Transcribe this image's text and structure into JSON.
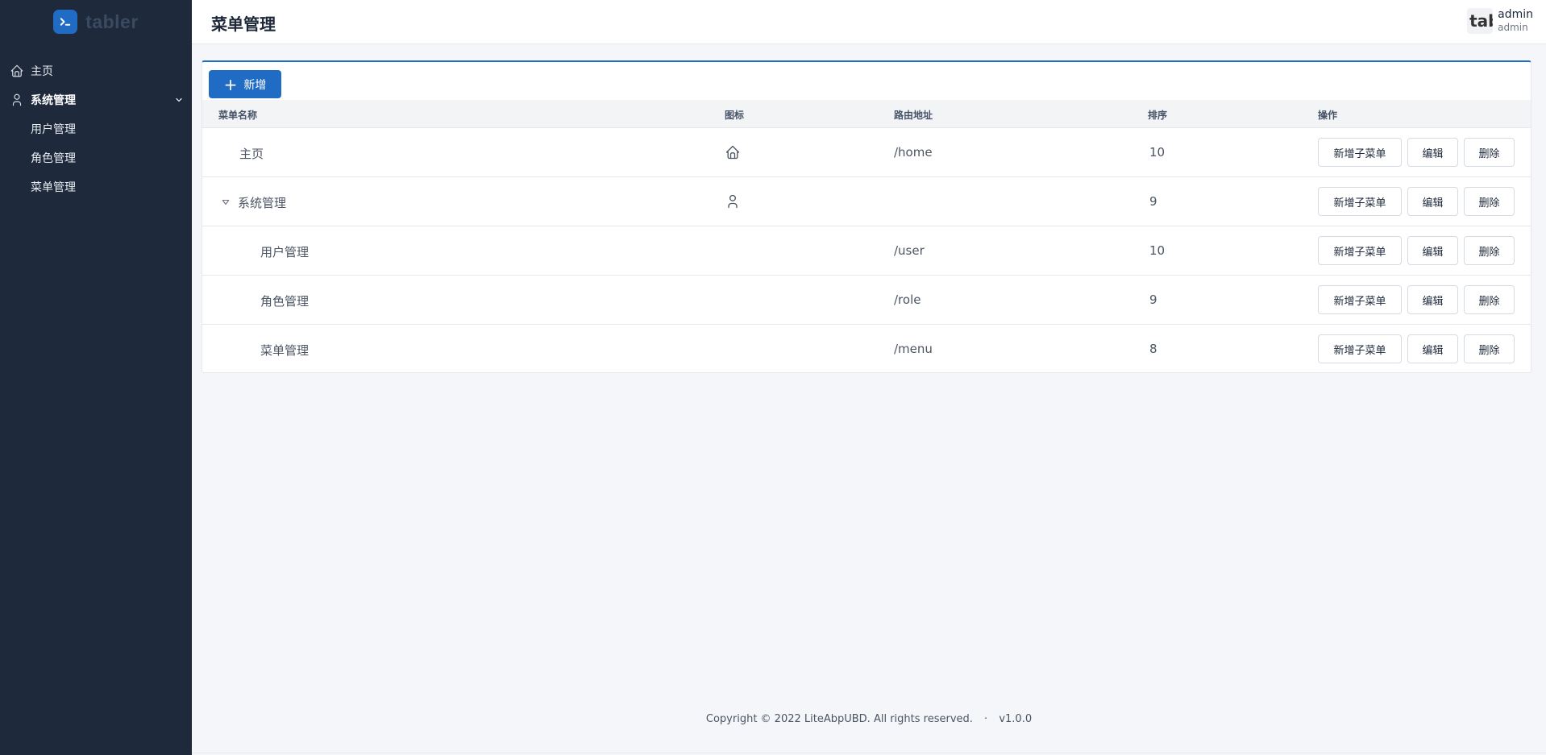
{
  "brand": {
    "name": "tabler",
    "logo_icon": "terminal-icon"
  },
  "sidebar": {
    "items": [
      {
        "label": "主页",
        "icon": "home-icon"
      },
      {
        "label": "系统管理",
        "icon": "user-icon",
        "expanded": true,
        "children": [
          {
            "label": "用户管理"
          },
          {
            "label": "角色管理"
          },
          {
            "label": "菜单管理"
          }
        ]
      }
    ]
  },
  "header": {
    "title": "菜单管理",
    "avatar_text": "tabler",
    "user_name": "admin",
    "user_role": "admin"
  },
  "toolbar": {
    "add_label": "新增"
  },
  "table": {
    "columns": [
      "菜单名称",
      "图标",
      "路由地址",
      "排序",
      "操作"
    ],
    "rows": [
      {
        "name": "主页",
        "icon": "home-icon",
        "route": "/home",
        "order": "10",
        "level": 0,
        "has_children": false
      },
      {
        "name": "系统管理",
        "icon": "user-icon",
        "route": "",
        "order": "9",
        "level": 0,
        "has_children": true,
        "expanded": true
      },
      {
        "name": "用户管理",
        "icon": "",
        "route": "/user",
        "order": "10",
        "level": 1,
        "has_children": false
      },
      {
        "name": "角色管理",
        "icon": "",
        "route": "/role",
        "order": "9",
        "level": 1,
        "has_children": false
      },
      {
        "name": "菜单管理",
        "icon": "",
        "route": "/menu",
        "order": "8",
        "level": 1,
        "has_children": false
      }
    ],
    "actions": {
      "add_child": "新增子菜单",
      "edit": "编辑",
      "delete": "删除"
    }
  },
  "footer": {
    "copyright": "Copyright © 2022 LiteAbpUBD. All rights reserved.",
    "separator": "·",
    "version": "v1.0.0"
  },
  "colors": {
    "sidebar_bg": "#1e293b",
    "primary": "#206bc4",
    "page_bg": "#f4f6fa"
  }
}
